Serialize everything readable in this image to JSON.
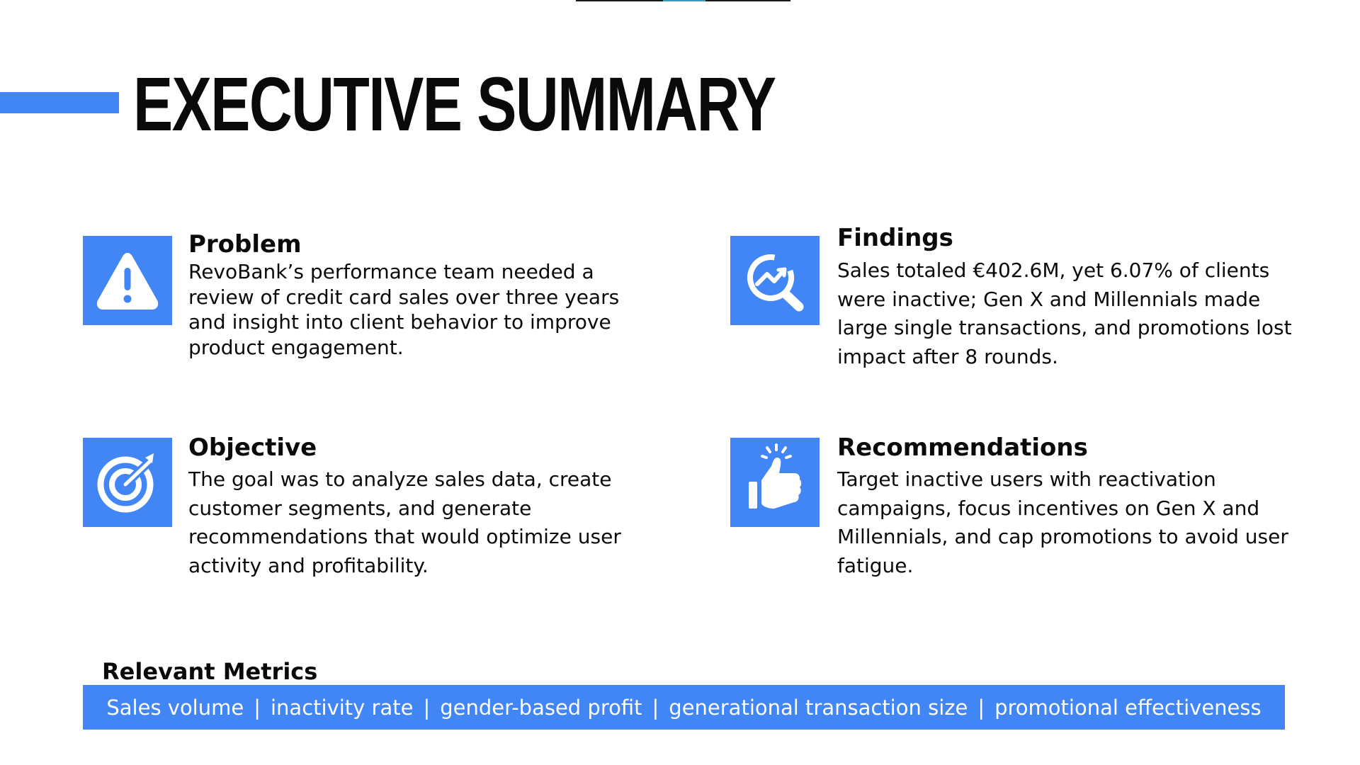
{
  "title": "EXECUTIVE SUMMARY",
  "colors": {
    "accent": "#4285f4",
    "text": "#0a0a0a",
    "background": "#ffffff"
  },
  "sections": {
    "problem": {
      "icon": "warning-icon",
      "heading": "Problem",
      "body": "RevoBank’s performance team needed a review of credit card sales over three years and insight into client behavior to improve product engagement."
    },
    "findings": {
      "icon": "analytics-search-icon",
      "heading": "Findings",
      "body": "Sales totaled €402.6M, yet 6.07% of clients were inactive; Gen X and Millennials made large single transactions, and promotions lost impact after 8 rounds."
    },
    "objective": {
      "icon": "target-icon",
      "heading": "Objective",
      "body": "The goal was to analyze sales data, create customer segments, and generate recommendations that would optimize user activity and profitability."
    },
    "recommendations": {
      "icon": "thumbs-up-icon",
      "heading": "Recommendations",
      "body": "Target inactive users with reactivation campaigns, focus incentives on Gen X and Millennials, and cap promotions to avoid user fatigue."
    }
  },
  "metrics": {
    "heading": "Relevant Metrics",
    "separator": "|",
    "items": [
      "Sales volume",
      "inactivity rate",
      "gender-based profit",
      "generational transaction size",
      "promotional effectiveness"
    ]
  }
}
